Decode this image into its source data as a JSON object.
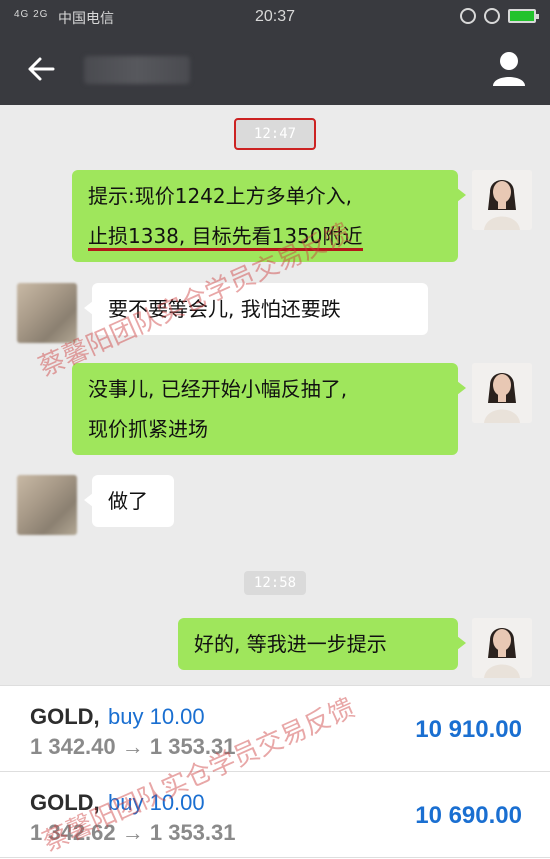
{
  "status_bar": {
    "signal": "4G 2G",
    "carrier": "中国电信",
    "time": "20:37"
  },
  "header": {
    "back_icon": "arrow-left-icon",
    "profile_icon": "person-icon"
  },
  "chat": {
    "messages": [
      {
        "type": "timestamp",
        "text": "12:47"
      },
      {
        "type": "me",
        "lines": [
          "提示:现价1242上方多单介入,",
          "止损1338, 目标先看1350附近"
        ]
      },
      {
        "type": "them",
        "lines": [
          "要不要等会儿, 我怕还要跌"
        ]
      },
      {
        "type": "me",
        "lines": [
          "没事儿, 已经开始小幅反抽了,",
          "现价抓紧进场"
        ]
      },
      {
        "type": "them",
        "lines": [
          "做了"
        ]
      },
      {
        "type": "timestamp",
        "text": "12:58"
      },
      {
        "type": "me",
        "lines": [
          "好的, 等我进一步提示"
        ]
      }
    ]
  },
  "trades": [
    {
      "symbol": "GOLD,",
      "side": "buy 10.00",
      "prices": "1 342.40 → 1 353.31",
      "profit": "10 910.00"
    },
    {
      "symbol": "GOLD,",
      "side": "buy 10.00",
      "prices": "1 342.62 → 1 353.31",
      "profit": "10 690.00"
    }
  ],
  "watermarks": [
    "蔡馨阳团队实仓学员交易反馈",
    "蔡馨阳团队实仓学员交易反馈"
  ],
  "colors": {
    "header_bg": "#393a3f",
    "chat_bg": "#ebebeb",
    "my_bubble": "#9fe65c",
    "their_bubble": "#ffffff",
    "profit_blue": "#1a6fd1",
    "underline_red": "#b21818"
  }
}
